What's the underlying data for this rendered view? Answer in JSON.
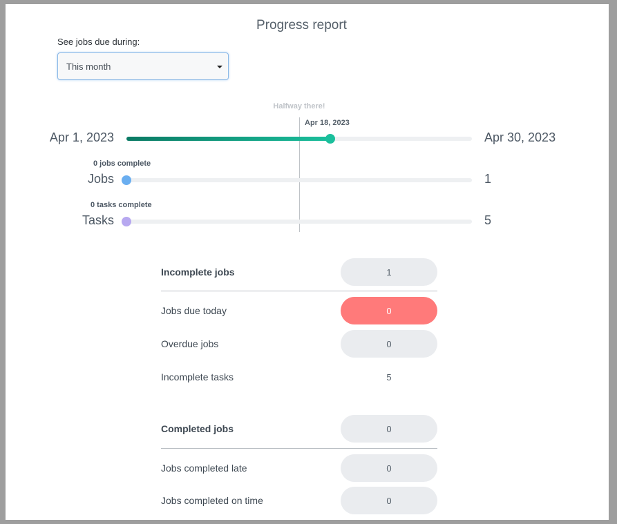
{
  "title": "Progress report",
  "filter": {
    "label": "See jobs due during:",
    "selected": "This month"
  },
  "timeline": {
    "milestone_label": "Halfway there!",
    "today_label": "Apr 18, 2023",
    "start_label": "Apr 1, 2023",
    "end_label": "Apr 30, 2023",
    "progress": 0.59
  },
  "jobs_bar": {
    "label": "Jobs",
    "status": "0 jobs complete",
    "total": "1",
    "progress": 0,
    "color": "#6aaef0"
  },
  "tasks_bar": {
    "label": "Tasks",
    "status": "0 tasks complete",
    "total": "5",
    "progress": 0,
    "color": "#b7a8f0"
  },
  "incomplete": {
    "header": {
      "label": "Incomplete jobs",
      "value": "1"
    },
    "rows": [
      {
        "label": "Jobs due today",
        "value": "0"
      },
      {
        "label": "Overdue jobs",
        "value": "0"
      },
      {
        "label": "Incomplete tasks",
        "value": "5"
      }
    ]
  },
  "completed": {
    "header": {
      "label": "Completed jobs",
      "value": "0"
    },
    "rows": [
      {
        "label": "Jobs completed late",
        "value": "0"
      },
      {
        "label": "Jobs completed on time",
        "value": "0"
      }
    ]
  },
  "colors": {
    "accent": "#1bbf9c",
    "accent_dark": "#0b7a64",
    "danger": "#ff7a7a"
  }
}
